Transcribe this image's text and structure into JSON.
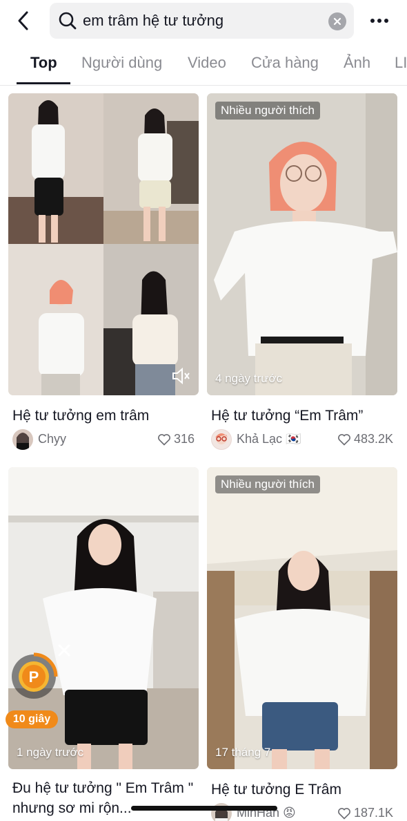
{
  "search": {
    "query": "em trâm hệ tư tưởng"
  },
  "icons": {
    "back": "chevron-left-icon",
    "search": "search-icon",
    "clear": "clear-x-icon",
    "more": "more-dots-icon",
    "heart": "heart-icon",
    "volume": "volume-icon"
  },
  "tabs": [
    {
      "label": "Top",
      "active": true
    },
    {
      "label": "Người dùng",
      "active": false
    },
    {
      "label": "Video",
      "active": false
    },
    {
      "label": "Cửa hàng",
      "active": false
    },
    {
      "label": "Ảnh",
      "active": false
    },
    {
      "label": "LI",
      "active": false
    }
  ],
  "results": [
    {
      "caption": "Hệ tư tưởng em trâm",
      "author": "Chyy",
      "likes": "316",
      "badge": "",
      "date": ""
    },
    {
      "caption": "Hệ tư tưởng “Em Trâm”",
      "author": "Khả Lạc 🇰🇷",
      "likes": "483.2K",
      "badge": "Nhiều người thích",
      "date": "4 ngày trước"
    },
    {
      "caption": "Đu hệ tư tưởng \" Em Trâm \" nhưng sơ mi rộn...",
      "author": "",
      "likes": "",
      "badge": "",
      "date": "1 ngày trước"
    },
    {
      "caption": "Hệ tư tưởng E Trâm",
      "author": "MinHan 😡",
      "likes": "187.1K",
      "badge": "Nhiều người thích",
      "date": "17 tháng 7"
    }
  ],
  "reward": {
    "timer": "10 giây",
    "coin_symbol": "P"
  },
  "colors": {
    "accent_orange": "#f08a1a",
    "text_primary": "#161823",
    "text_secondary": "#8a8b91"
  }
}
